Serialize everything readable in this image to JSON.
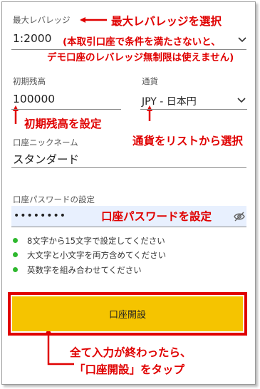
{
  "form": {
    "leverage": {
      "label": "最大レバレッジ",
      "value": "1:2000"
    },
    "balance": {
      "label": "初期残高",
      "value": "100000"
    },
    "currency": {
      "label": "通貨",
      "value": "JPY - 日本円"
    },
    "nickname": {
      "label": "口座ニックネーム",
      "value": "スタンダード"
    },
    "password": {
      "label": "口座パスワードの設定",
      "value": "••••••••"
    },
    "requirements": [
      "8文字から15文字で設定してください",
      "大文字と小文字を両方含めてください",
      "英数字を組み合わせてください"
    ],
    "submit_label": "口座開設"
  },
  "annotations": {
    "leverage_select": "最大レバレッジを選択",
    "leverage_note_line1": "(本取引口座で条件を満たさないと、",
    "leverage_note_line2": "デモ口座のレバレッジ無制限は使えません)",
    "balance_set": "初期残高を設定",
    "currency_select": "通貨をリストから選択",
    "password_set": "口座パスワードを設定",
    "submit_line1": "全て入力が終わったら、",
    "submit_line2": "「口座開設」をタップ"
  },
  "colors": {
    "annotation_red": "#e00000",
    "button_yellow": "#f5c400",
    "bullet_green": "#2eb82e",
    "password_highlight": "#e8f0fe"
  },
  "icons": [
    "chevron-down-icon",
    "eye-off-icon"
  ]
}
